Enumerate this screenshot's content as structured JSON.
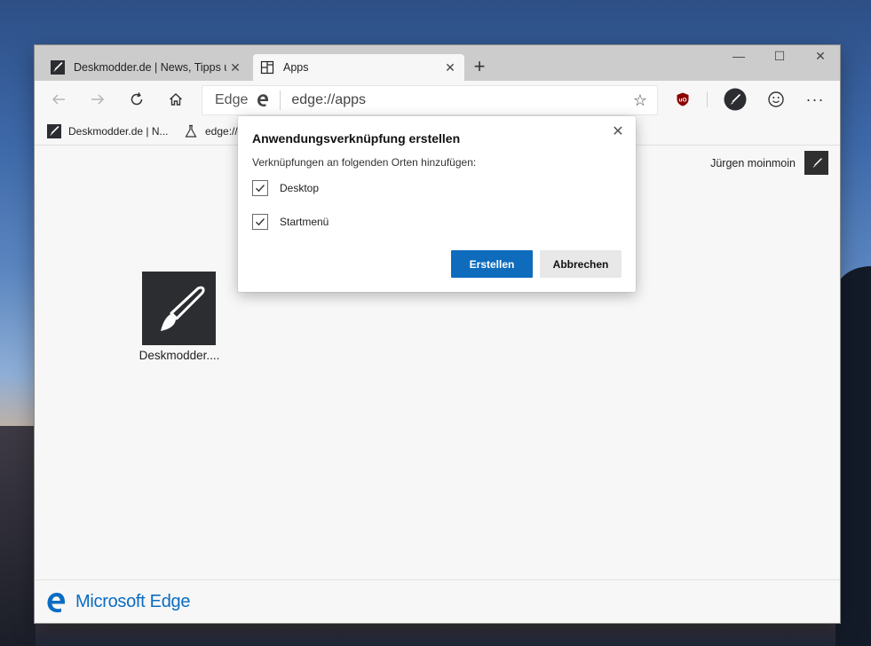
{
  "tabs": [
    {
      "title": "Deskmodder.de | News, Tipps und",
      "active": false
    },
    {
      "title": "Apps",
      "active": true
    }
  ],
  "toolbar": {
    "address_prefix": "Edge",
    "address_url": "edge://apps"
  },
  "favorites": [
    {
      "label": "Deskmodder.de | N..."
    },
    {
      "label": "edge://"
    }
  ],
  "page": {
    "profile_name": "Jürgen moinmoin",
    "apps": [
      {
        "label": "Deskmodder...."
      }
    ],
    "footer_brand": "Microsoft Edge"
  },
  "dialog": {
    "title": "Anwendungsverknüpfung erstellen",
    "subtitle": "Verknüpfungen an folgenden Orten hinzufügen:",
    "options": [
      {
        "label": "Desktop",
        "checked": true
      },
      {
        "label": "Startmenü",
        "checked": true
      }
    ],
    "primary_label": "Erstellen",
    "secondary_label": "Abbrechen"
  },
  "colors": {
    "accent": "#0f6cbd",
    "brand": "#0a6cc2",
    "tabstrip": "#cccccc",
    "ublock": "#8b0000"
  }
}
